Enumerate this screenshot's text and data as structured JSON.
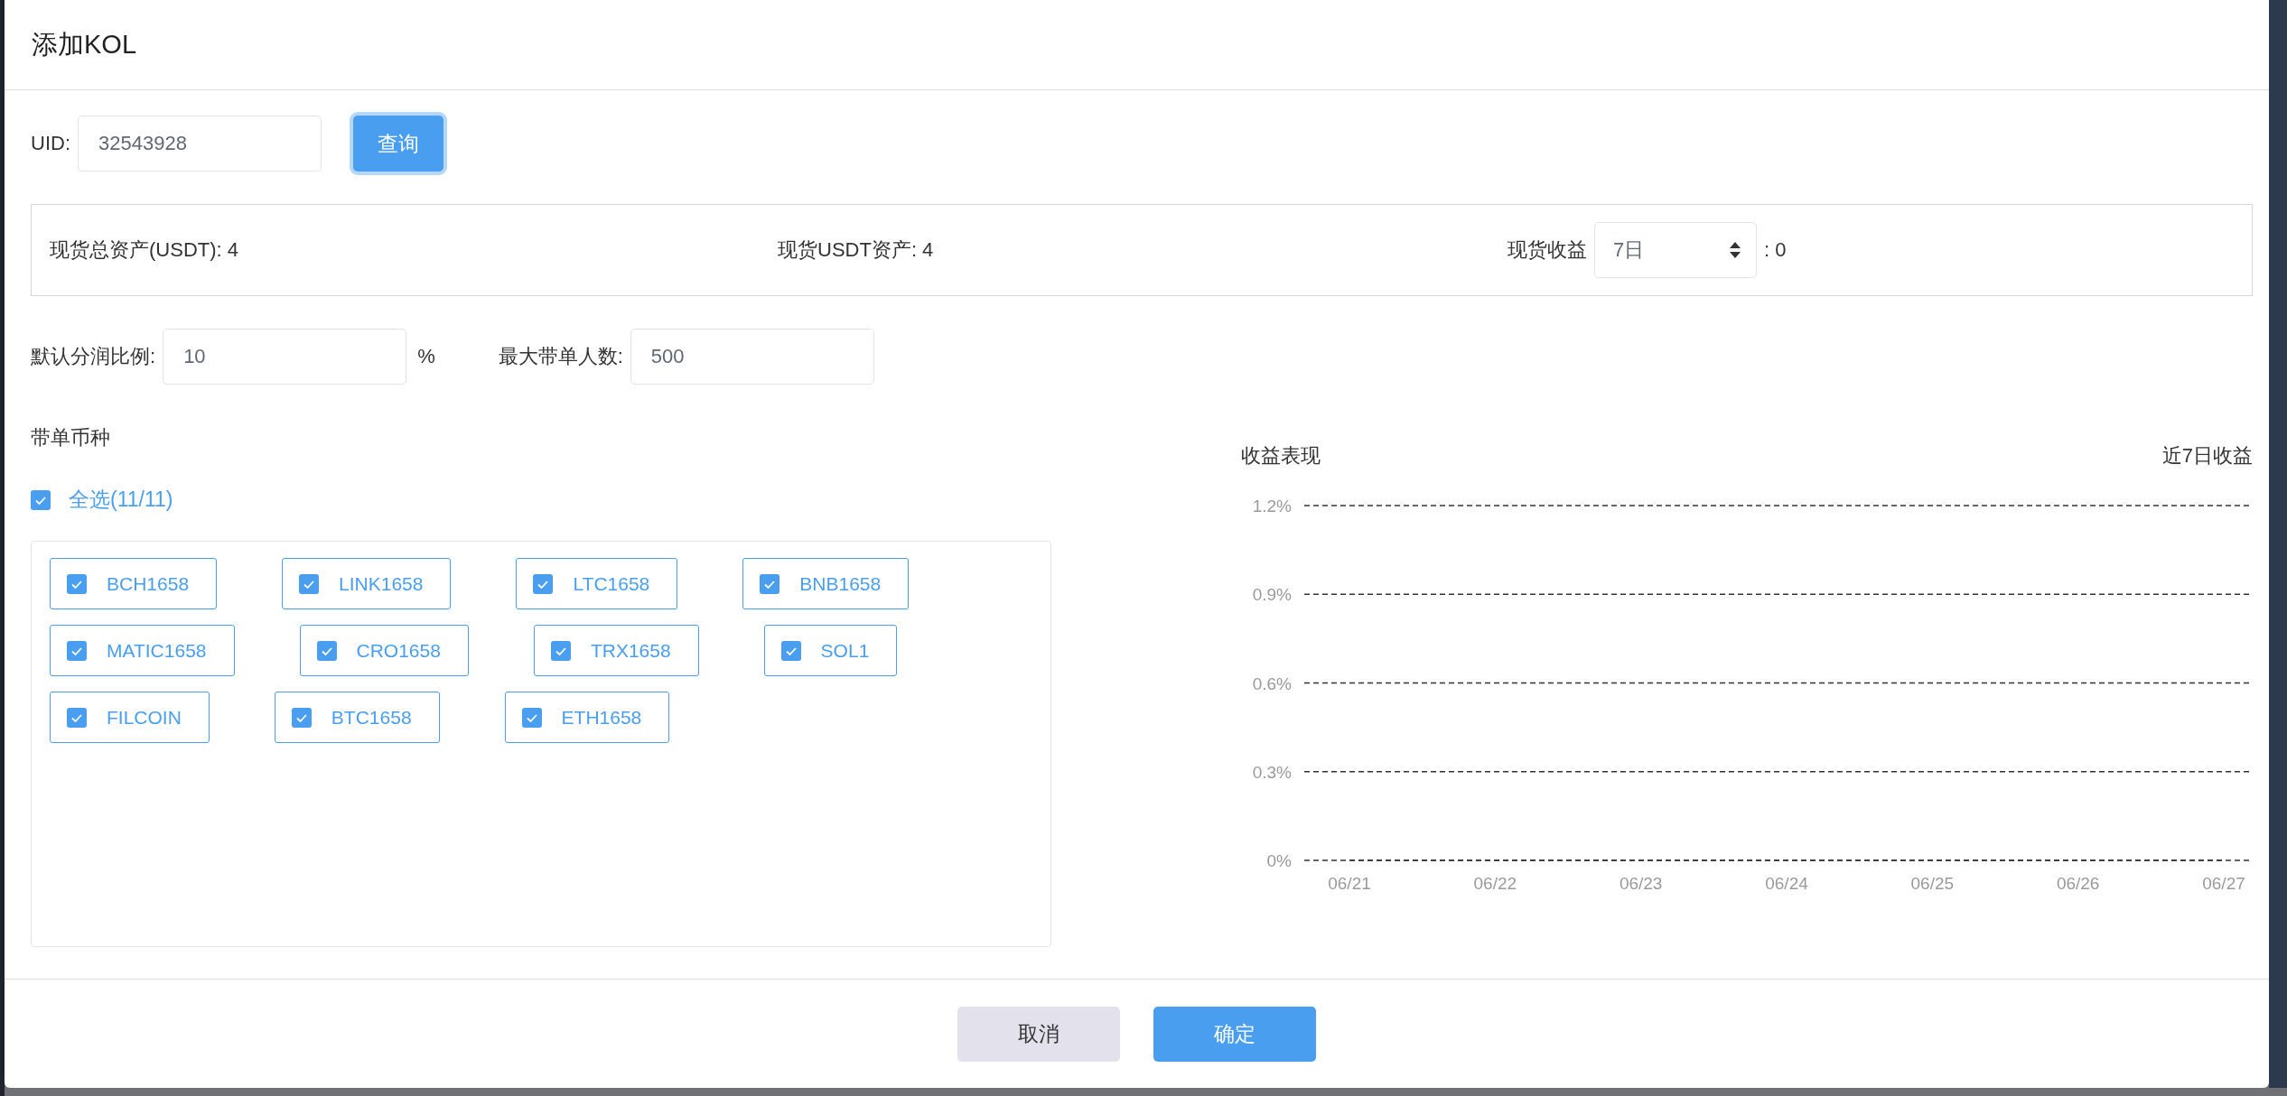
{
  "dialog": {
    "title": "添加KOL"
  },
  "uid": {
    "label": "UID:",
    "value": "32543928"
  },
  "query_button": {
    "label": "查询"
  },
  "summary": [
    {
      "kind": "text",
      "text": "现货总资产(USDT): 4"
    },
    {
      "kind": "text",
      "text": "现货USDT资产: 4"
    },
    {
      "kind": "select",
      "label": "现货收益",
      "value": "7日",
      "suffix": ": 0"
    }
  ],
  "settings": [
    {
      "label": "默认分润比例:",
      "value": "10",
      "unit": "%"
    },
    {
      "label": "最大带单人数:",
      "value": "500"
    }
  ],
  "coins": {
    "title": "带单币种",
    "select_all": {
      "label": "全选(11/11)",
      "checked": true
    },
    "items": [
      {
        "label": "BCH1658",
        "checked": true
      },
      {
        "label": "LINK1658",
        "checked": true
      },
      {
        "label": "LTC1658",
        "checked": true
      },
      {
        "label": "BNB1658",
        "checked": true
      },
      {
        "label": "MATIC1658",
        "checked": true
      },
      {
        "label": "CRO1658",
        "checked": true
      },
      {
        "label": "TRX1658",
        "checked": true
      },
      {
        "label": "SOL1",
        "checked": true
      },
      {
        "label": "FILCOIN",
        "checked": true
      },
      {
        "label": "BTC1658",
        "checked": true
      },
      {
        "label": "ETH1658",
        "checked": true
      }
    ]
  },
  "performance": {
    "title": "收益表现",
    "subtitle": "近7日收益",
    "chart_data": {
      "type": "line",
      "categories": [
        "06/21",
        "06/22",
        "06/23",
        "06/24",
        "06/25",
        "06/26",
        "06/27"
      ],
      "series": [
        {
          "color": "#333333",
          "line_style": "dashed",
          "values": [
            0,
            0,
            0,
            0,
            0,
            0,
            0
          ]
        }
      ],
      "ylim": [
        0,
        1.2
      ],
      "yticks": [
        {
          "value": 0,
          "label": "0%"
        },
        {
          "value": 0.3,
          "label": "0.3%"
        },
        {
          "value": 0.6,
          "label": "0.6%"
        },
        {
          "value": 0.9,
          "label": "0.9%"
        },
        {
          "value": 1.2,
          "label": "1.2%"
        }
      ]
    }
  },
  "buttons": [
    {
      "label": "取消",
      "kind": "secondary"
    },
    {
      "label": "确定",
      "kind": "primary"
    }
  ]
}
